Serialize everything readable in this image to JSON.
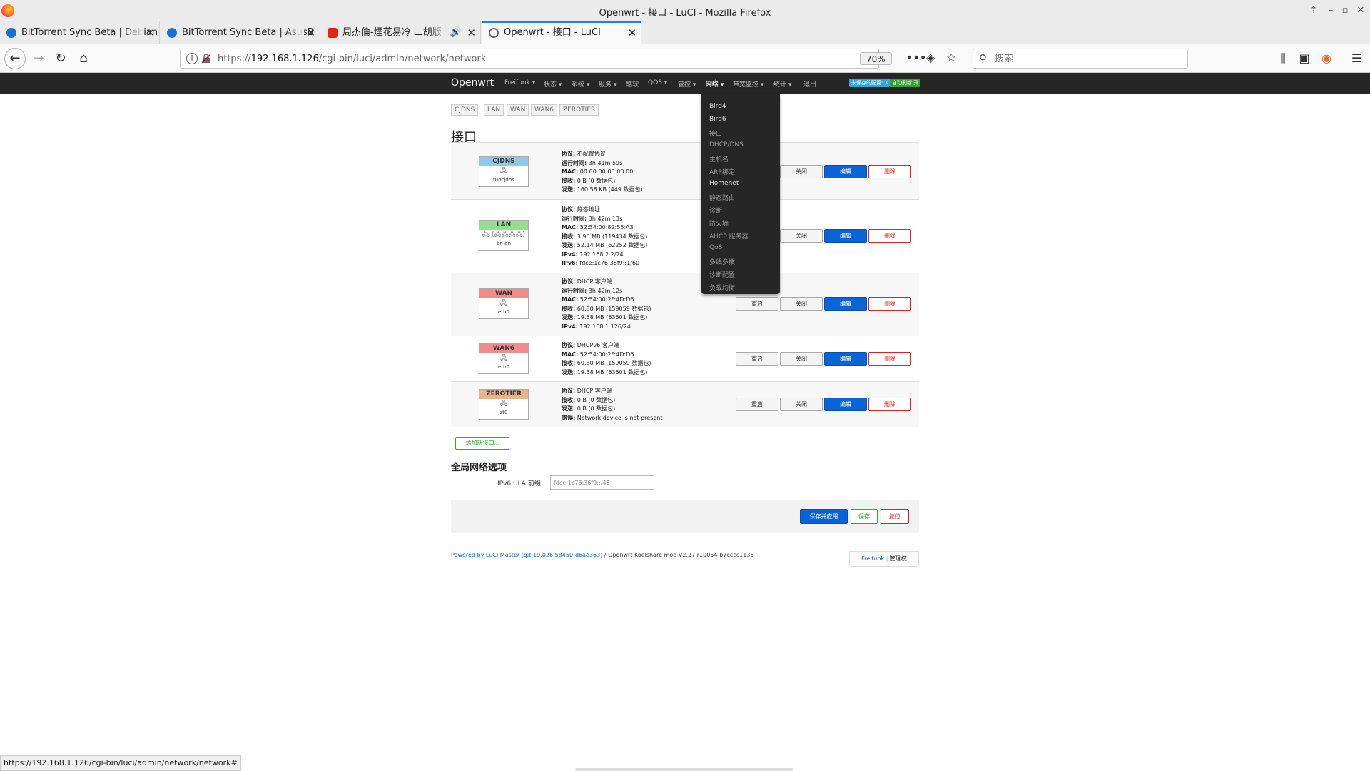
{
  "window": {
    "title": "Openwrt - 接口 - LuCI - Mozilla Firefox"
  },
  "tabs": [
    {
      "label": "BitTorrent Sync Beta | Debian",
      "icon": "bittorrent-icon",
      "color": "#1f6fd0",
      "active": false
    },
    {
      "label": "BitTorrent Sync Beta | AsusB",
      "icon": "bittorrent-icon",
      "color": "#1f6fd0",
      "active": false
    },
    {
      "label": "周杰倫-煙花易冷 二胡版",
      "icon": "youtube-icon",
      "color": "#e62117",
      "active": false
    },
    {
      "label": "Openwrt - 接口 - LuCI",
      "icon": "openwrt-icon",
      "color": "#666666",
      "active": true
    }
  ],
  "urlbar": {
    "url_prefix": "https://",
    "url_host": "192.168.1.126",
    "url_path": "/cgi-bin/luci/admin/network/network",
    "zoom": "70%"
  },
  "search": {
    "placeholder": "搜索"
  },
  "luci": {
    "brand": "Openwrt",
    "menu": [
      "Freifunk",
      "状态",
      "系统",
      "服务",
      "酷软",
      "QOS",
      "管控",
      "网络",
      "带宽监控",
      "统计",
      "退出"
    ],
    "badges": [
      {
        "label": "未保存的配置: 3",
        "color": "#2aa9e0"
      },
      {
        "label": "自动刷新 开",
        "color": "#2ea52e"
      }
    ],
    "dropdown": [
      "Bird4",
      "Bird6",
      "接口",
      "DHCP/DNS",
      "主机名",
      "ARP绑定",
      "Homenet",
      "静态路由",
      "诊断",
      "防火墙",
      "AHCP 服务器",
      "QoS",
      "多线多拨",
      "诊断配置",
      "负载均衡"
    ],
    "subtabs": [
      "CJDNS",
      "LAN",
      "WAN",
      "WAN6",
      "ZEROTIER"
    ],
    "page_title": "接口",
    "buttons": {
      "restart": "重启",
      "stop": "关闭",
      "edit": "编辑",
      "delete": "删除"
    },
    "interfaces": [
      {
        "name": "CJDNS",
        "head_color": "#8ec8ea",
        "device": "tuncjdns",
        "icon": "network-port-icon",
        "details": [
          {
            "k": "协议:",
            "v": "不配置协议"
          },
          {
            "k": "运行时间:",
            "v": "3h 41m 59s"
          },
          {
            "k": "MAC:",
            "v": "00:00:00:00:00:00"
          },
          {
            "k": "接收:",
            "v": "0 B (0 数据包)"
          },
          {
            "k": "发送:",
            "v": "160.58 KB (449 数据包)"
          }
        ]
      },
      {
        "name": "LAN",
        "head_color": "#90e090",
        "device": "br-lan",
        "icon": "bridge-icon",
        "details": [
          {
            "k": "协议:",
            "v": "静态地址"
          },
          {
            "k": "运行时间:",
            "v": "3h 42m 13s"
          },
          {
            "k": "MAC:",
            "v": "52:54:00:82:55:A3"
          },
          {
            "k": "接收:",
            "v": "3.96 MB (119434 数据包)"
          },
          {
            "k": "发送:",
            "v": "52.14 MB (62252 数据包)"
          },
          {
            "k": "IPv4:",
            "v": "192.168.2.2/24"
          },
          {
            "k": "IPv6:",
            "v": "fdce:1c76:36f9::1/60"
          }
        ]
      },
      {
        "name": "WAN",
        "head_color": "#f08c8c",
        "device": "eth0",
        "icon": "network-port-icon",
        "details": [
          {
            "k": "协议:",
            "v": "DHCP 客户端"
          },
          {
            "k": "运行时间:",
            "v": "3h 42m 12s"
          },
          {
            "k": "MAC:",
            "v": "52:54:00:2F:4D:D6"
          },
          {
            "k": "接收:",
            "v": "60.80 MB (159059 数据包)"
          },
          {
            "k": "发送:",
            "v": "19.58 MB (63601 数据包)"
          },
          {
            "k": "IPv4:",
            "v": "192.168.1.126/24"
          }
        ]
      },
      {
        "name": "WAN6",
        "head_color": "#f08c8c",
        "device": "eth0",
        "icon": "network-port-icon",
        "details": [
          {
            "k": "协议:",
            "v": "DHCPv6 客户端"
          },
          {
            "k": "MAC:",
            "v": "52:54:00:2F:4D:D6"
          },
          {
            "k": "接收:",
            "v": "60.80 MB (159059 数据包)"
          },
          {
            "k": "发送:",
            "v": "19.58 MB (63601 数据包)"
          }
        ]
      },
      {
        "name": "ZEROTIER",
        "head_color": "#e8b48c",
        "device": "zt0",
        "icon": "network-port-icon",
        "details": [
          {
            "k": "协议:",
            "v": "DHCP 客户端"
          },
          {
            "k": "接收:",
            "v": "0 B (0 数据包)"
          },
          {
            "k": "发送:",
            "v": "0 B (0 数据包)"
          },
          {
            "k": "错误:",
            "v": "Network device is not present"
          }
        ]
      }
    ],
    "add_interface": "添加新接口...",
    "global_section": "全局网络选项",
    "ula_label": "IPv6 ULA 前缀",
    "ula_value": "fdce:1c76:36f9::/48",
    "save_apply": "保存并应用",
    "save": "保存",
    "reset": "复位",
    "footer_link": "Powered by LuCI Master (git-19.026.58450-d6ae363)",
    "footer_rest": " / Openwrt Koolshare mod V2.27 r10054-b7cccc1136",
    "footer_freifunk": "Freifunk",
    "footer_admin": "管理权"
  },
  "statusbar": "https://192.168.1.126/cgi-bin/luci/admin/network/network#"
}
